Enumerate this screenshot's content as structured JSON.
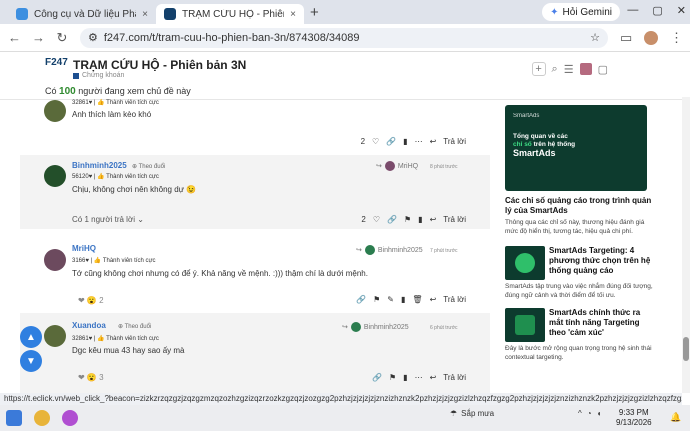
{
  "tabs": [
    {
      "label": "Công cụ và Dữ liệu Phân tích kỹ",
      "close": "×"
    },
    {
      "label": "TRẠM CỨU HỘ - Phiên bản 3N",
      "close": "×"
    }
  ],
  "newtab": "+",
  "gemini": "Hỏi Gemini",
  "window": {
    "min": "—",
    "max": "▢",
    "close": "✕"
  },
  "address": {
    "url": "f247.com/t/tram-cuu-ho-phien-ban-3n/874308/34089"
  },
  "site": {
    "logo": "F247",
    "title": "TRẠM CỨU HỘ - Phiên bản 3N",
    "category": "Chứng khoán",
    "viewers_prefix": "Có",
    "viewers_count": "100",
    "viewers_suffix": "người đang xem chủ đề này"
  },
  "posts": [
    {
      "meta": "32861♥ | 👍 Thành viên tích cực",
      "text": "Anh thích làm kèo khó",
      "count": "2",
      "reply": "Trả lời"
    },
    {
      "name": "Binhminh2025",
      "follow": "Theo đuổi",
      "replyto": "MriHQ",
      "time": "8 phút trước",
      "meta": "56120♥ | 👍 Thành viên tích cực",
      "text": "Chịu, không chơi nên không dự 😉",
      "replies": "Có 1 người trả lời ⌄",
      "count": "2",
      "reply": "Trả lời"
    },
    {
      "name": "MriHQ",
      "replyto": "Binhminh2025",
      "time": "7 phút trước",
      "meta": "3166♥ | 👍 Thành viên tích cực",
      "text": "Tớ cũng không chơi nhưng có để ý. Khả năng về mệnh. :))) thậm chí là dưới mệnh.",
      "react": "❤ 😮 2",
      "reply": "Trả lời"
    },
    {
      "name": "Xuandoa",
      "follow": "Theo đuổi",
      "replyto": "Binhminh2025",
      "time": "6 phút trước",
      "meta": "32861♥ | 👍 Thành viên tích cực",
      "text": "Dgc kêu mua 43 hay sao ấy mà",
      "react": "❤ 😮 3",
      "reply": "Trả lời"
    }
  ],
  "sidebar": {
    "promo_brand": "SmartAds",
    "promo_text": "Tổng quan về các",
    "promo_hl": "chỉ số",
    "promo_text2": "trên hệ thống",
    "promo_brand2": "SmartAds",
    "items": [
      {
        "title": "Các chỉ số quảng cáo trong trình quản lý của SmartAds",
        "desc": "Thông qua các chỉ số này, thương hiệu đánh giá mức độ hiển thị, tương tác, hiệu quả chi phí."
      },
      {
        "title": "SmartAds Targeting: 4 phương thức chọn trên hệ thống quảng cáo",
        "desc": "SmartAds tập trung vào việc nhắm đúng đối tượng, đúng ngữ cảnh và thời điểm để tối ưu."
      },
      {
        "title": "SmartAds chính thức ra mắt tính năng Targeting theo 'cảm xúc'",
        "desc": "Đây là bước mở rộng quan trọng trong hệ sinh thái contextual targeting."
      }
    ]
  },
  "status_url": "https://t.eclick.vn/web_click_?beacon=zizkzrzqzgzjzqzgzmzqzozhzgzizqzrzozkzgzqzjzozgzg2pzhzjzjzjzjzjznzizhznzk2pzhzjzjzjzgzizlzhzqzfzgzg2pzhzjzjzjzjzjznzizhznzk2pzhzjzjzjzgzizlzhzqzfzgzg2pzhzjzjzjz",
  "weather": "Sắp mưa",
  "clock": {
    "time": "9:33 PM",
    "date": "9/13/2026"
  }
}
